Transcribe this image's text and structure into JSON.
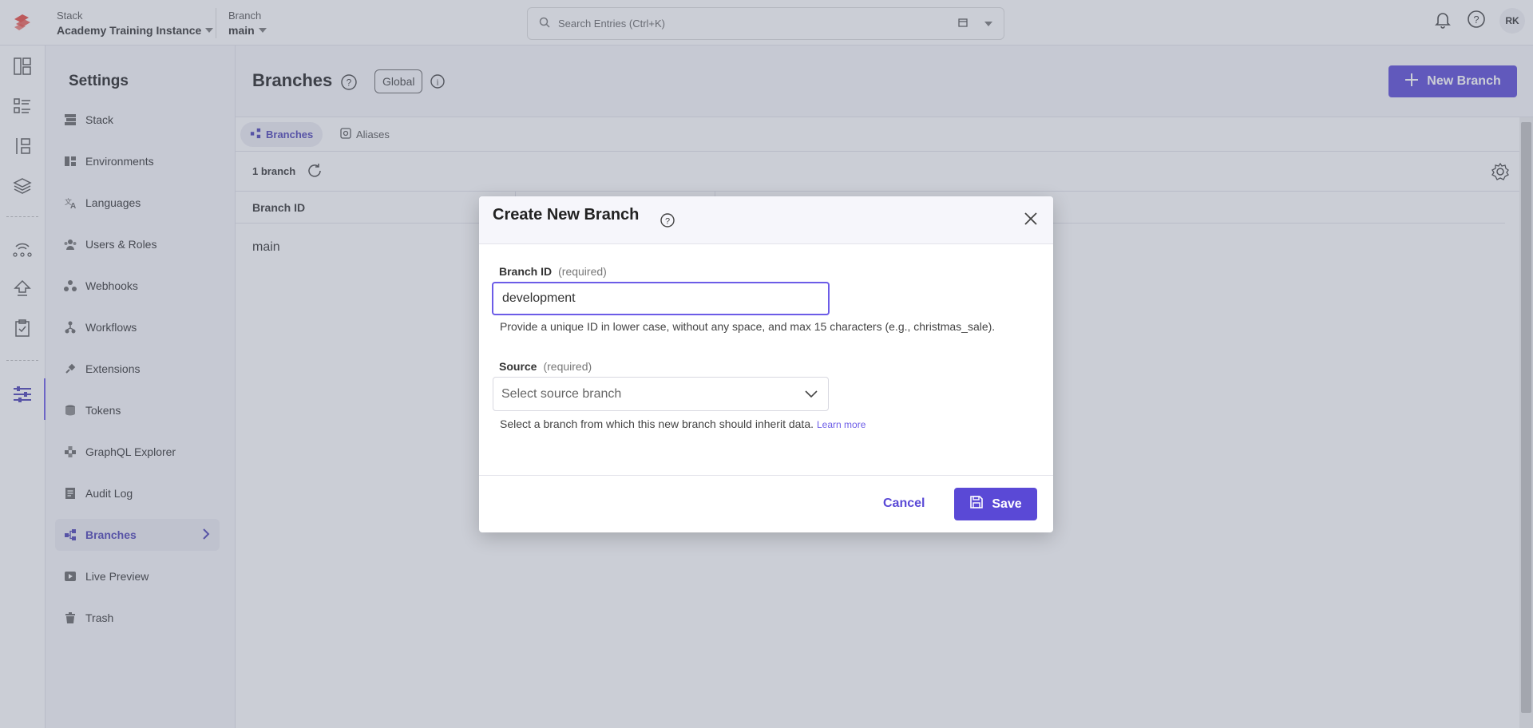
{
  "topbar": {
    "stack_label": "Stack",
    "stack_value": "Academy Training Instance",
    "branch_label": "Branch",
    "branch_value": "main",
    "search_placeholder": "Search Entries (Ctrl+K)",
    "avatar_initials": "RK"
  },
  "settings": {
    "title": "Settings",
    "items": [
      {
        "label": "Stack",
        "icon": "stack-icon"
      },
      {
        "label": "Environments",
        "icon": "environments-icon"
      },
      {
        "label": "Languages",
        "icon": "languages-icon"
      },
      {
        "label": "Users & Roles",
        "icon": "users-icon"
      },
      {
        "label": "Webhooks",
        "icon": "webhooks-icon"
      },
      {
        "label": "Workflows",
        "icon": "workflows-icon"
      },
      {
        "label": "Extensions",
        "icon": "extensions-icon"
      },
      {
        "label": "Tokens",
        "icon": "tokens-icon"
      },
      {
        "label": "GraphQL Explorer",
        "icon": "graphql-icon"
      },
      {
        "label": "Audit Log",
        "icon": "audit-log-icon"
      },
      {
        "label": "Branches",
        "icon": "branches-icon",
        "active": true
      },
      {
        "label": "Live Preview",
        "icon": "live-preview-icon"
      },
      {
        "label": "Trash",
        "icon": "trash-icon"
      }
    ]
  },
  "page": {
    "title": "Branches",
    "badge": "Global",
    "new_button": "New Branch",
    "tabs": [
      {
        "label": "Branches",
        "active": true
      },
      {
        "label": "Aliases"
      }
    ],
    "count": "1 branch",
    "column_header": "Branch ID",
    "rows": [
      "main"
    ]
  },
  "modal": {
    "title": "Create New Branch",
    "branch_id_label": "Branch ID",
    "branch_id_required": "(required)",
    "branch_id_value": "development",
    "branch_id_hint": "Provide a unique ID in lower case, without any space, and max 15 characters (e.g., christmas_sale).",
    "source_label": "Source",
    "source_required": "(required)",
    "source_placeholder": "Select source branch",
    "source_hint": "Select a branch from which this new branch should inherit data.",
    "learn_more": "Learn more",
    "cancel_label": "Cancel",
    "save_label": "Save"
  },
  "colors": {
    "accent": "#5a49d6",
    "brand": "#e8483f"
  }
}
